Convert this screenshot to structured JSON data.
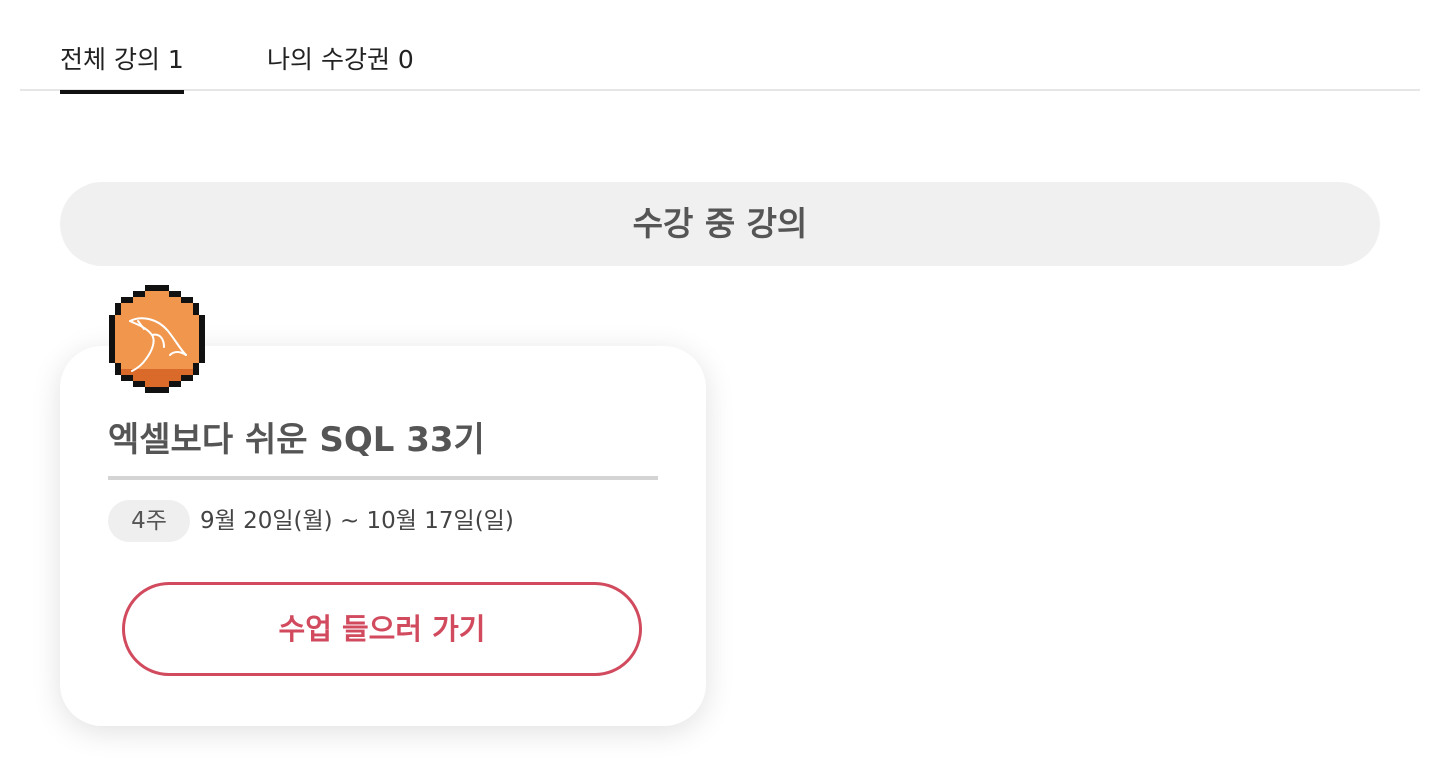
{
  "tabs": [
    {
      "label": "전체 강의 1",
      "active": true
    },
    {
      "label": "나의 수강권 0",
      "active": false
    }
  ],
  "section": {
    "title": "수강 중 강의"
  },
  "course": {
    "icon": "mysql-dolphin-icon",
    "title": "엑셀보다 쉬운 SQL 33기",
    "duration": "4주",
    "schedule": "9월 20일(월) ~ 10월 17일(일)",
    "button_label": "수업 들으러 가기"
  },
  "colors": {
    "accent": "#d14a5e",
    "icon_orange": "#f0964d",
    "icon_orange_dark": "#d96a2a",
    "pill_bg": "#f0f0f0"
  }
}
